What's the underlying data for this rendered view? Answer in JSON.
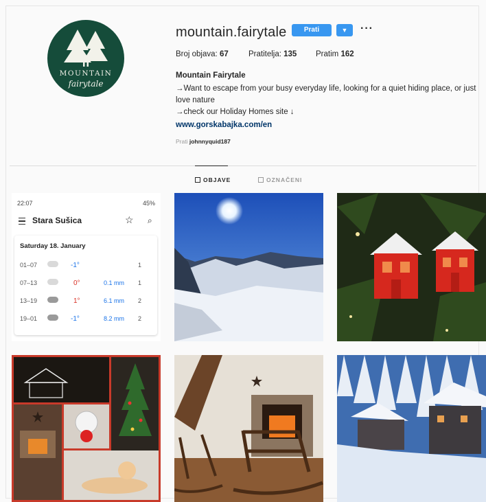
{
  "profile": {
    "username": "mountain.fairytale",
    "follow_label": "Prati",
    "dropdown_icon": "caret-down-icon",
    "more_label": "···",
    "stats": [
      {
        "label": "Broj objava:",
        "value": "67"
      },
      {
        "label": "Pratitelja:",
        "value": "135"
      },
      {
        "label": "Pratim",
        "value": "162"
      }
    ],
    "full_name": "Mountain Fairytale",
    "bio_lines": [
      "→Want to escape from your busy everyday life, looking for a quiet hiding place, or just",
      "love nature",
      "→check our Holiday Homes site ↓"
    ],
    "link": "www.gorskabajka.com/en",
    "followed_by_label": "Prati",
    "followed_by_user": "johnnyquid187",
    "avatar_text_1": "MOUNTAIN",
    "avatar_text_2": "fairytale"
  },
  "tabs": [
    {
      "label": "OBJAVE",
      "active": true
    },
    {
      "label": "OZNAČENI",
      "active": false
    }
  ],
  "weather": {
    "status_time": "22:07",
    "status_right": "45%",
    "city": "Stara Sušica",
    "date": "Saturday 18. January",
    "rows": [
      {
        "time": "01–07",
        "temp": "-1°",
        "precip": "",
        "wind": "1",
        "icon": "cloud-icon"
      },
      {
        "time": "07–13",
        "temp": "0°",
        "precip": "0.1 mm",
        "wind": "1",
        "icon": "cloud-icon"
      },
      {
        "time": "13–19",
        "temp": "1°",
        "precip": "6.1 mm",
        "wind": "2",
        "icon": "rain-cloud-icon"
      },
      {
        "time": "19–01",
        "temp": "-1°",
        "precip": "8.2 mm",
        "wind": "2",
        "icon": "rain-cloud-icon"
      }
    ]
  },
  "colors": {
    "accent": "#3897f0",
    "link": "#003569",
    "avatar_bg": "#154c3a",
    "temp_cold": "#1a73e8",
    "temp_warm": "#d93025"
  }
}
